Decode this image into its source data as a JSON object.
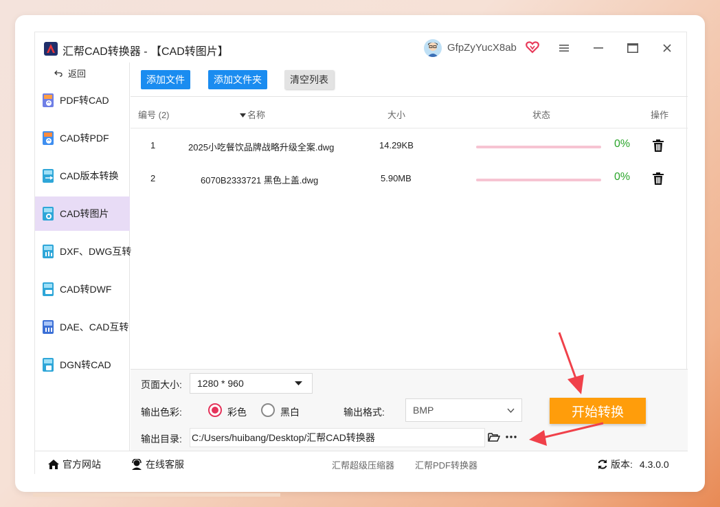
{
  "window": {
    "title": "汇帮CAD转换器 - 【CAD转图片】",
    "username": "GfpZyYucX8ab",
    "icons": [
      "app-logo",
      "avatar",
      "vip-heart-icon",
      "menu-icon",
      "minimize-icon",
      "maximize-icon",
      "close-icon"
    ]
  },
  "sidebar": {
    "back_label": "返回",
    "items": [
      {
        "label": "PDF转CAD"
      },
      {
        "label": "CAD转PDF"
      },
      {
        "label": "CAD版本转换"
      },
      {
        "label": "CAD转图片",
        "active": true
      },
      {
        "label": "DXF、DWG互转"
      },
      {
        "label": "CAD转DWF"
      },
      {
        "label": "DAE、CAD互转"
      },
      {
        "label": "DGN转CAD"
      }
    ]
  },
  "toolbar": {
    "add_file": "添加文件",
    "add_folder": "添加文件夹",
    "clear_list": "清空列表"
  },
  "table": {
    "headers": {
      "number": "编号 (2)",
      "name": "名称",
      "size": "大小",
      "status": "状态",
      "action": "操作"
    },
    "rows": [
      {
        "no": "1",
        "name": "2025小吃餐饮品牌战略升级全案.dwg",
        "size": "14.29KB",
        "progress": 0,
        "percent": "0%"
      },
      {
        "no": "2",
        "name": "6070B2333721 黑色上盖.dwg",
        "size": "5.90MB",
        "progress": 0,
        "percent": "0%"
      }
    ]
  },
  "settings": {
    "page_size_label": "页面大小:",
    "page_size_value": "1280 * 960",
    "color_label": "输出色彩:",
    "color_option_color": "彩色",
    "color_option_bw": "黑白",
    "color_selected": "彩色",
    "format_label": "输出格式:",
    "format_value": "BMP",
    "dir_label": "输出目录:",
    "dir_value": "C:/Users/huibang/Desktop/汇帮CAD转换器",
    "start_button": "开始转换"
  },
  "footer": {
    "website": "官方网站",
    "support": "在线客服",
    "compressor": "汇帮超级压缩器",
    "pdf_converter": "汇帮PDF转换器",
    "version_label": "版本:",
    "version_value": "4.3.0.0"
  },
  "colors": {
    "accent_blue": "#1a8cf0",
    "start_orange": "#ff9d0b",
    "active_sidebar": "#e8dcf6",
    "progress_pink": "#f6c4d2",
    "percent_green": "#2aa52a",
    "radio_red": "#e5335a",
    "annotation_arrow": "#f0414a"
  }
}
